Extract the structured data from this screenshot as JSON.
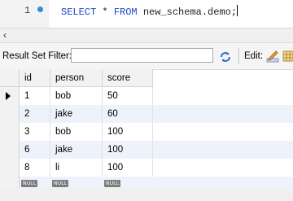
{
  "editor": {
    "line_number": "1",
    "kw_select": "SELECT",
    "code_star": " * ",
    "kw_from": "FROM",
    "code_table": " new_schema.demo;"
  },
  "toolbar": {
    "filter_label": "Result Set Filter:",
    "filter_value": "",
    "edit_label": "Edit:"
  },
  "grid": {
    "columns": [
      "id",
      "person",
      "score"
    ],
    "rows": [
      [
        "1",
        "bob",
        "50"
      ],
      [
        "2",
        "jake",
        "60"
      ],
      [
        "3",
        "bob",
        "100"
      ],
      [
        "6",
        "jake",
        "100"
      ],
      [
        "8",
        "li",
        "100"
      ]
    ],
    "null_label": "NULL"
  },
  "colors": {
    "keyword": "#1a47c4",
    "alt_row": "#eef3fb",
    "marker_dot": "#2f8fd8"
  }
}
